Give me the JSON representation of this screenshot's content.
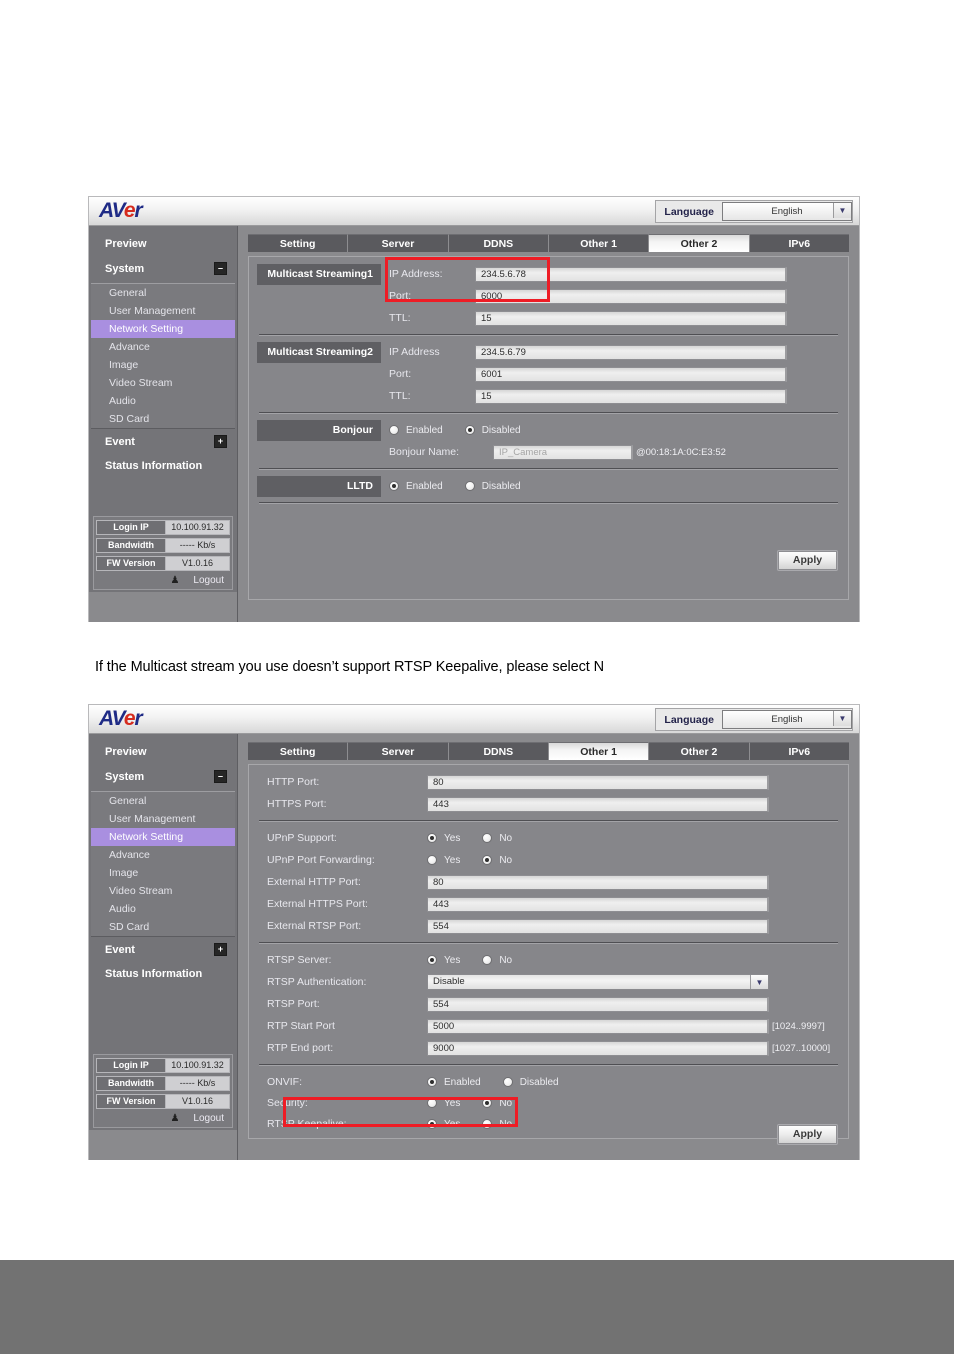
{
  "caption": "If the Multicast stream you use doesn’t support RTSP Keepalive, please select N",
  "logo": {
    "part1": "AV",
    "part2": "e",
    "part3": "r"
  },
  "header": {
    "language_label": "Language",
    "language_value": "English",
    "dropdown_icon": "▼"
  },
  "sidebar": {
    "preview": "Preview",
    "system": "System",
    "system_toggle": "–",
    "items": [
      {
        "label": "General",
        "active": false
      },
      {
        "label": "User Management",
        "active": false
      },
      {
        "label": "Network Setting",
        "active": true
      },
      {
        "label": "Advance",
        "active": false
      },
      {
        "label": "Image",
        "active": false
      },
      {
        "label": "Video Stream",
        "active": false
      },
      {
        "label": "Audio",
        "active": false
      },
      {
        "label": "SD Card",
        "active": false
      }
    ],
    "event": "Event",
    "event_toggle": "+",
    "status_information": "Status Information",
    "status": [
      {
        "key": "Login IP",
        "value": "10.100.91.32"
      },
      {
        "key": "Bandwidth",
        "value": "----- Kb/s"
      },
      {
        "key": "FW Version",
        "value": "V1.0.16"
      }
    ],
    "logout_label": "Logout",
    "logout_icon": "♟"
  },
  "tabs": [
    "Setting",
    "Server",
    "DDNS",
    "Other 1",
    "Other 2",
    "IPv6"
  ],
  "panel_multicast": {
    "active_tab": "Other 2",
    "section1_label": "Multicast Streaming1",
    "section2_label": "Multicast Streaming2",
    "fields1": [
      {
        "label": "IP Address:",
        "value": "234.5.6.78"
      },
      {
        "label": "Port:",
        "value": "6000"
      },
      {
        "label": "TTL:",
        "value": "15"
      }
    ],
    "fields2": [
      {
        "label": "IP Address",
        "value": "234.5.6.79"
      },
      {
        "label": "Port:",
        "value": "6001"
      },
      {
        "label": "TTL:",
        "value": "15"
      }
    ],
    "bonjour_label": "Bonjour",
    "bonjour_enabled": "Enabled",
    "bonjour_disabled": "Disabled",
    "bonjour_name_label": "Bonjour Name:",
    "bonjour_name_value": "IP_Camera",
    "bonjour_mac": "@00:18:1A:0C:E3:52",
    "lltd_label": "LLTD",
    "lltd_enabled": "Enabled",
    "lltd_disabled": "Disabled",
    "apply": "Apply"
  },
  "panel_other1": {
    "active_tab": "Other 1",
    "http_port_label": "HTTP Port:",
    "http_port_value": "80",
    "https_port_label": "HTTPS Port:",
    "https_port_value": "443",
    "upnp_support_label": "UPnP Support:",
    "upnp_forward_label": "UPnP Port Forwarding:",
    "yes": "Yes",
    "no": "No",
    "ext_http_label": "External HTTP Port:",
    "ext_http_value": "80",
    "ext_https_label": "External HTTPS Port:",
    "ext_https_value": "443",
    "ext_rtsp_label": "External RTSP Port:",
    "ext_rtsp_value": "554",
    "rtsp_server_label": "RTSP Server:",
    "rtsp_auth_label": "RTSP Authentication:",
    "rtsp_auth_value": "Disable",
    "rtsp_port_label": "RTSP Port:",
    "rtsp_port_value": "554",
    "rtp_start_label": "RTP Start Port",
    "rtp_start_value": "5000",
    "rtp_start_range": "[1024..9997]",
    "rtp_end_label": "RTP End port:",
    "rtp_end_value": "9000",
    "rtp_end_range": "[1027..10000]",
    "onvif_label": "ONVIF:",
    "onvif_enabled": "Enabled",
    "onvif_disabled": "Disabled",
    "security_label": "Security:",
    "keepalive_label": "RTSP Keepalive:",
    "apply": "Apply"
  }
}
